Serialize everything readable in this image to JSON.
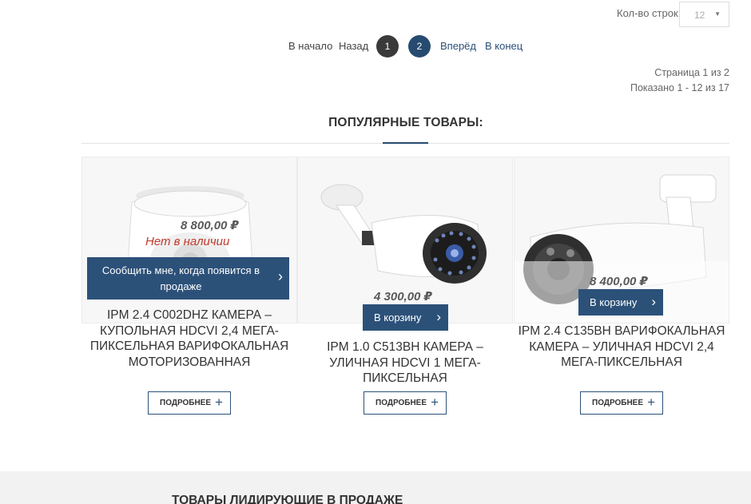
{
  "rows_per_page": {
    "label": "Кол-во строк:",
    "value": "12"
  },
  "pagination": {
    "start": "В начало",
    "back": "Назад",
    "pages": [
      "1",
      "2"
    ],
    "next": "Вперёд",
    "end": "В конец"
  },
  "page_info": {
    "page": "Страница 1 из 2",
    "shown": "Показано 1 - 12 из 17"
  },
  "section_title": "ПОПУЛЯРНЫЕ ТОВАРЫ:",
  "products": [
    {
      "price": "8 800,00 ₽",
      "stock": "Нет в наличии",
      "notify_label": "Сообщить мне, когда появится в продаже",
      "name": "IPM 2.4 C002DHZ Камера – купольная HDCVI 2,4 Мега-пиксельная варифокальная моторизованная",
      "more_label": "ПОДРОБНЕЕ"
    },
    {
      "price": "4 300,00 ₽",
      "cart_label": "В корзину",
      "name": "IPM 1.0 C513BH Камера – уличная HDCVI 1 Мега-пиксельная",
      "more_label": "ПОДРОБНЕЕ"
    },
    {
      "price": "8 400,00 ₽",
      "cart_label": "В корзину",
      "name": "IPM 2.4 C135BH Варифокальная камера – уличная HDCVI 2,4 Мега-пиксельная",
      "more_label": "ПОДРОБНЕЕ"
    }
  ],
  "bottom_section_title": "ТОВАРЫ ЛИДИРУЮЩИЕ В ПРОДАЖЕ",
  "colors": {
    "accent": "#2c5179",
    "active_page": "#274b70",
    "current_page": "#3a3a3a",
    "out_of_stock": "#c0392b"
  },
  "icons": {
    "chevron": "chevron-right-icon",
    "plus": "plus-icon",
    "caret": "caret-down-icon"
  }
}
